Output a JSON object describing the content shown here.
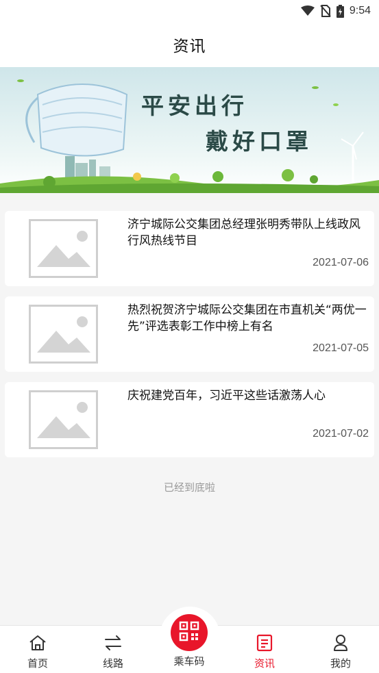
{
  "status_bar": {
    "time": "9:54",
    "icons": [
      "wifi-icon",
      "no-sim-icon",
      "battery-charging-icon"
    ]
  },
  "header": {
    "title": "资讯"
  },
  "banner": {
    "line1": "平安出行",
    "line2": "戴好口罩",
    "colors": {
      "sky": "#dfeff0",
      "grass": "#7cc043",
      "text": "#2b4a47"
    }
  },
  "news": [
    {
      "title": "济宁城际公交集团总经理张明秀带队上线政风行风热线节目",
      "date": "2021-07-06",
      "thumbnail_icon": "image-placeholder-icon"
    },
    {
      "title": "热烈祝贺济宁城际公交集团在市直机关“两优一先”评选表彰工作中榜上有名",
      "date": "2021-07-05",
      "thumbnail_icon": "image-placeholder-icon"
    },
    {
      "title": "庆祝建党百年，习近平这些话激荡人心",
      "date": "2021-07-02",
      "thumbnail_icon": "image-placeholder-icon"
    }
  ],
  "list_end_message": "已经到底啦",
  "tabbar": {
    "tabs": [
      {
        "label": "首页",
        "icon": "home-icon"
      },
      {
        "label": "线路",
        "icon": "route-swap-icon"
      },
      {
        "label": "乘车码",
        "icon": "qr-code-icon"
      },
      {
        "label": "资讯",
        "icon": "news-icon",
        "active": true
      },
      {
        "label": "我的",
        "icon": "user-icon"
      }
    ],
    "active_color": "#e8162a",
    "inactive_color": "#333333"
  }
}
